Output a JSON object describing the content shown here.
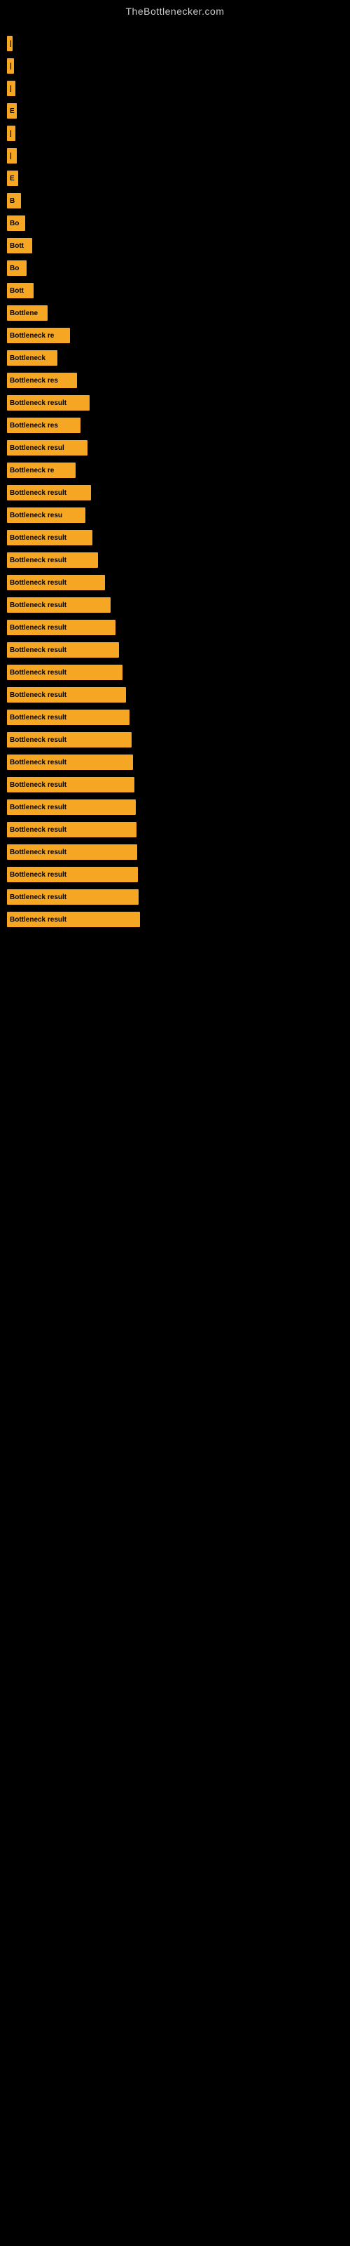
{
  "site": {
    "title": "TheBottlenecker.com"
  },
  "bars": [
    {
      "label": "|",
      "width": 8
    },
    {
      "label": "|",
      "width": 10
    },
    {
      "label": "|",
      "width": 12
    },
    {
      "label": "E",
      "width": 14
    },
    {
      "label": "|",
      "width": 12
    },
    {
      "label": "|",
      "width": 14
    },
    {
      "label": "E",
      "width": 16
    },
    {
      "label": "B",
      "width": 20
    },
    {
      "label": "Bo",
      "width": 26
    },
    {
      "label": "Bott",
      "width": 36
    },
    {
      "label": "Bo",
      "width": 28
    },
    {
      "label": "Bott",
      "width": 38
    },
    {
      "label": "Bottlene",
      "width": 58
    },
    {
      "label": "Bottleneck re",
      "width": 90
    },
    {
      "label": "Bottleneck",
      "width": 72
    },
    {
      "label": "Bottleneck res",
      "width": 100
    },
    {
      "label": "Bottleneck result",
      "width": 118
    },
    {
      "label": "Bottleneck res",
      "width": 105
    },
    {
      "label": "Bottleneck resul",
      "width": 115
    },
    {
      "label": "Bottleneck re",
      "width": 98
    },
    {
      "label": "Bottleneck result",
      "width": 120
    },
    {
      "label": "Bottleneck resu",
      "width": 112
    },
    {
      "label": "Bottleneck result",
      "width": 122
    },
    {
      "label": "Bottleneck result",
      "width": 130
    },
    {
      "label": "Bottleneck result",
      "width": 140
    },
    {
      "label": "Bottleneck result",
      "width": 148
    },
    {
      "label": "Bottleneck result",
      "width": 155
    },
    {
      "label": "Bottleneck result",
      "width": 160
    },
    {
      "label": "Bottleneck result",
      "width": 165
    },
    {
      "label": "Bottleneck result",
      "width": 170
    },
    {
      "label": "Bottleneck result",
      "width": 175
    },
    {
      "label": "Bottleneck result",
      "width": 178
    },
    {
      "label": "Bottleneck result",
      "width": 180
    },
    {
      "label": "Bottleneck result",
      "width": 182
    },
    {
      "label": "Bottleneck result",
      "width": 184
    },
    {
      "label": "Bottleneck result",
      "width": 185
    },
    {
      "label": "Bottleneck result",
      "width": 186
    },
    {
      "label": "Bottleneck result",
      "width": 187
    },
    {
      "label": "Bottleneck result",
      "width": 188
    },
    {
      "label": "Bottleneck result",
      "width": 190
    }
  ]
}
